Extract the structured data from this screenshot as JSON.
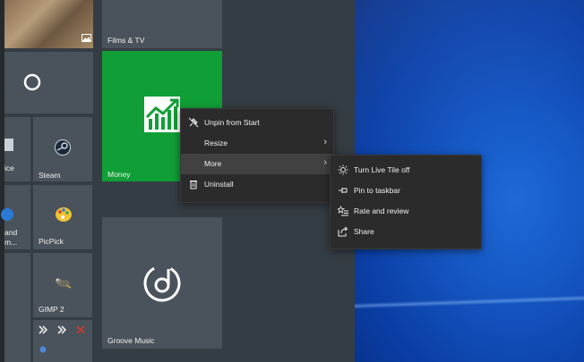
{
  "start_menu": {
    "tiles": {
      "films_tv": {
        "label": "Films & TV"
      },
      "money": {
        "label": "Money",
        "color": "#109e36"
      },
      "groove": {
        "label": "Groove Music"
      },
      "steam": {
        "label": "Steam"
      },
      "picpick": {
        "label": "PicPick"
      },
      "gimp": {
        "label": "GIMP 2"
      },
      "partial_office": {
        "label": "ice"
      },
      "partial_and": {
        "label": "and"
      },
      "partial_m": {
        "label": "m..."
      }
    }
  },
  "context_menu": {
    "items": [
      {
        "label": "Unpin from Start",
        "icon": "unpin-icon"
      },
      {
        "label": "Resize",
        "icon": "",
        "has_submenu": true
      },
      {
        "label": "More",
        "icon": "",
        "has_submenu": true,
        "highlighted": true
      },
      {
        "label": "Uninstall",
        "icon": "trash-icon"
      }
    ]
  },
  "submenu": {
    "items": [
      {
        "label": "Turn Live Tile off",
        "icon": "sun-icon"
      },
      {
        "label": "Pin to taskbar",
        "icon": "pin-icon"
      },
      {
        "label": "Rate and review",
        "icon": "star-list-icon"
      },
      {
        "label": "Share",
        "icon": "share-icon"
      }
    ]
  },
  "colors": {
    "desktop_blue": "#1556c2",
    "menu_bg": "#2b2b2b",
    "tile_gray": "#4a535b"
  }
}
